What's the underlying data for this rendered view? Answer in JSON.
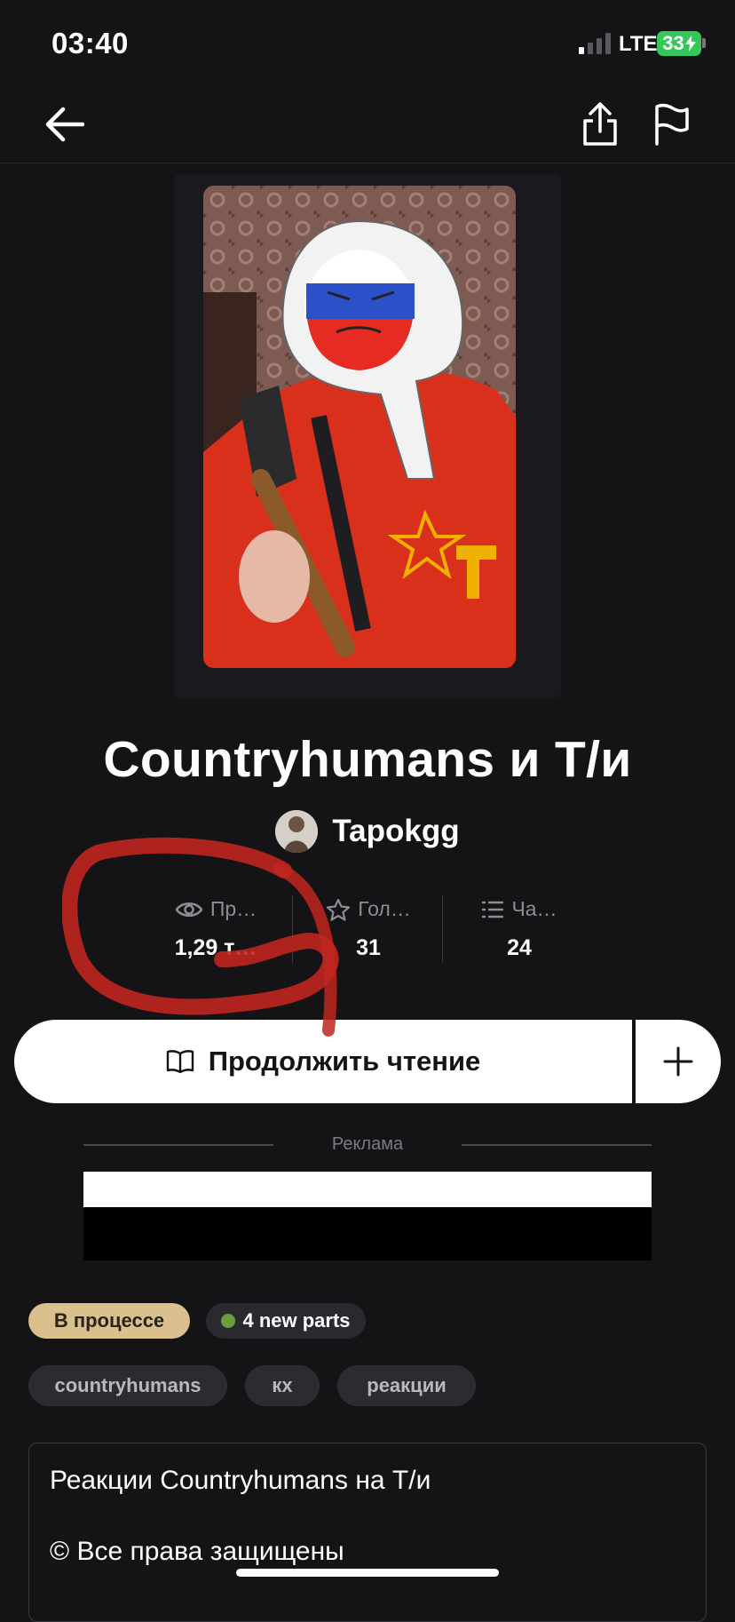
{
  "status_bar": {
    "time": "03:40",
    "network": "LTE",
    "battery": "33"
  },
  "header": {
    "back_icon": "arrow-left-icon",
    "share_icon": "share-icon",
    "report_icon": "flag-icon"
  },
  "story": {
    "title": "Countryhumans и Т/и",
    "author": "Tapokgg",
    "stats": [
      {
        "icon": "eye-icon",
        "label": "Пр…",
        "value": "1,29 т…"
      },
      {
        "icon": "star-icon",
        "label": "Гол…",
        "value": "31"
      },
      {
        "icon": "list-icon",
        "label": "Ча…",
        "value": "24"
      }
    ]
  },
  "actions": {
    "continue_label": "Продолжить чтение",
    "add_icon": "plus-icon"
  },
  "ad": {
    "label": "Реклама"
  },
  "badges": {
    "status": "В процессе",
    "new_parts": "4 new parts"
  },
  "tags": [
    "countryhumans",
    "кх",
    "реакции"
  ],
  "description": {
    "line1": "Реакции Countryhumans на Т/и",
    "line2": "© Все права защищены"
  },
  "colors": {
    "background": "#141316",
    "status_pill": "#d9c08e",
    "new_parts_dot": "#6a9e3e",
    "annotation": "#c0261f"
  }
}
